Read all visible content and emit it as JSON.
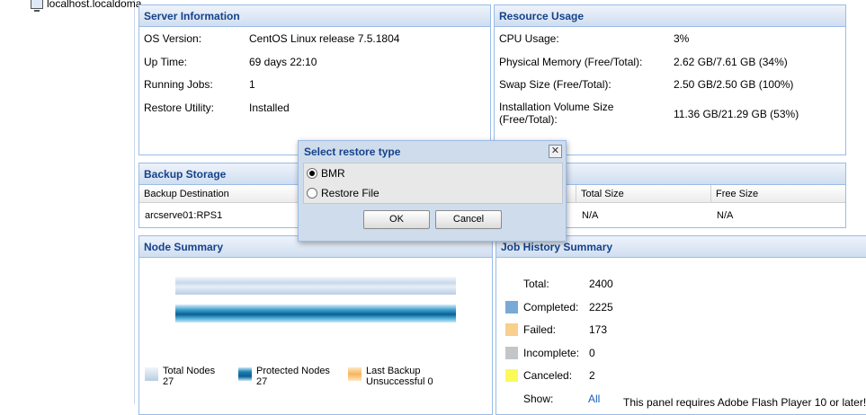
{
  "tree": {
    "host_label": "localhost.localdoma"
  },
  "server_info": {
    "title": "Server Information",
    "rows": [
      {
        "key": "OS Version:",
        "value": "CentOS Linux release 7.5.1804"
      },
      {
        "key": "Up Time:",
        "value": "69 days 22:10"
      },
      {
        "key": "Running Jobs:",
        "value": "1"
      },
      {
        "key": "Restore Utility:",
        "value": "Installed"
      }
    ]
  },
  "resource_usage": {
    "title": "Resource Usage",
    "rows": [
      {
        "key": "CPU Usage:",
        "value": "3%"
      },
      {
        "key": "Physical Memory (Free/Total):",
        "value": "2.62 GB/7.61 GB (34%)"
      },
      {
        "key": "Swap Size (Free/Total):",
        "value": "2.50 GB/2.50 GB (100%)"
      },
      {
        "key_line1": "Installation Volume Size",
        "key_line2": "(Free/Total):",
        "value": "11.36 GB/21.29 GB (53%)"
      }
    ]
  },
  "backup_storage": {
    "title": "Backup Storage",
    "columns": [
      "Backup Destination",
      "Total Size",
      "Free Size"
    ],
    "rows": [
      {
        "destination": "arcserve01:RPS1",
        "total": "N/A",
        "free": "N/A"
      }
    ]
  },
  "node_summary": {
    "title": "Node Summary",
    "legend": [
      {
        "label": "Total Nodes",
        "value": "27",
        "color": "#c5d6e8"
      },
      {
        "label": "Protected Nodes",
        "value": "27",
        "color": "#1a7fb5"
      },
      {
        "label": "Last Backup",
        "label2": "Unsuccessful",
        "value": "0",
        "color": "#f7c27a"
      }
    ]
  },
  "job_history": {
    "title": "Job History Summary",
    "rows": [
      {
        "label": "Total:",
        "value": "2400",
        "color": ""
      },
      {
        "label": "Completed:",
        "value": "2225",
        "color": "#7aa9d6"
      },
      {
        "label": "Failed:",
        "value": "173",
        "color": "#f8cf8c"
      },
      {
        "label": "Incomplete:",
        "value": "0",
        "color": "#c2c6c9"
      },
      {
        "label": "Canceled:",
        "value": "2",
        "color": "#fafa5a"
      }
    ],
    "show_label": "Show:",
    "show_value": "All",
    "flash_notice": "This panel requires Adobe Flash Player 10 or later!"
  },
  "dialog": {
    "title": "Select restore type",
    "options": [
      {
        "label": "BMR",
        "selected": true
      },
      {
        "label": "Restore File",
        "selected": false
      }
    ],
    "ok_label": "OK",
    "cancel_label": "Cancel"
  }
}
